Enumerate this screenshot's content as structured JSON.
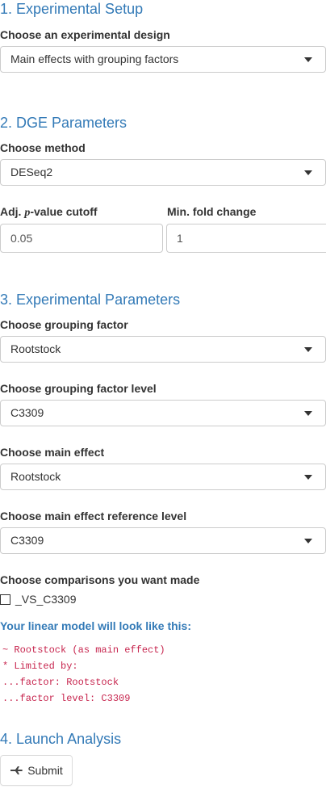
{
  "sections": {
    "setup": {
      "title": "1. Experimental Setup"
    },
    "dge": {
      "title": "2. DGE Parameters"
    },
    "params": {
      "title": "3. Experimental Parameters"
    },
    "launch": {
      "title": "4. Launch Analysis"
    }
  },
  "design": {
    "label": "Choose an experimental design",
    "value": "Main effects with grouping factors"
  },
  "method": {
    "label": "Choose method",
    "value": "DESeq2"
  },
  "pvalue": {
    "label_prefix": "Adj. ",
    "label_p": "p",
    "label_suffix": "-value cutoff",
    "value": "0.05"
  },
  "foldchange": {
    "label": "Min. fold change",
    "value": "1"
  },
  "grouping_factor": {
    "label": "Choose grouping factor",
    "value": "Rootstock"
  },
  "grouping_level": {
    "label": "Choose grouping factor level",
    "value": "C3309"
  },
  "main_effect": {
    "label": "Choose main effect",
    "value": "Rootstock"
  },
  "main_effect_ref": {
    "label": "Choose main effect reference level",
    "value": "C3309"
  },
  "comparisons": {
    "label": "Choose comparisons you want made",
    "options": [
      {
        "label": "_VS_C3309",
        "checked": false
      }
    ]
  },
  "model": {
    "heading": "Your linear model will look like this:",
    "lines": [
      "~ Rootstock (as main effect)",
      "* Limited by:",
      "...factor: Rootstock",
      "...factor level: C3309"
    ]
  },
  "submit": {
    "label": "Submit",
    "icon": "paper-plane-icon"
  },
  "colors": {
    "accent": "#337ab7",
    "code": "#c7254e",
    "border": "#cccccc"
  }
}
